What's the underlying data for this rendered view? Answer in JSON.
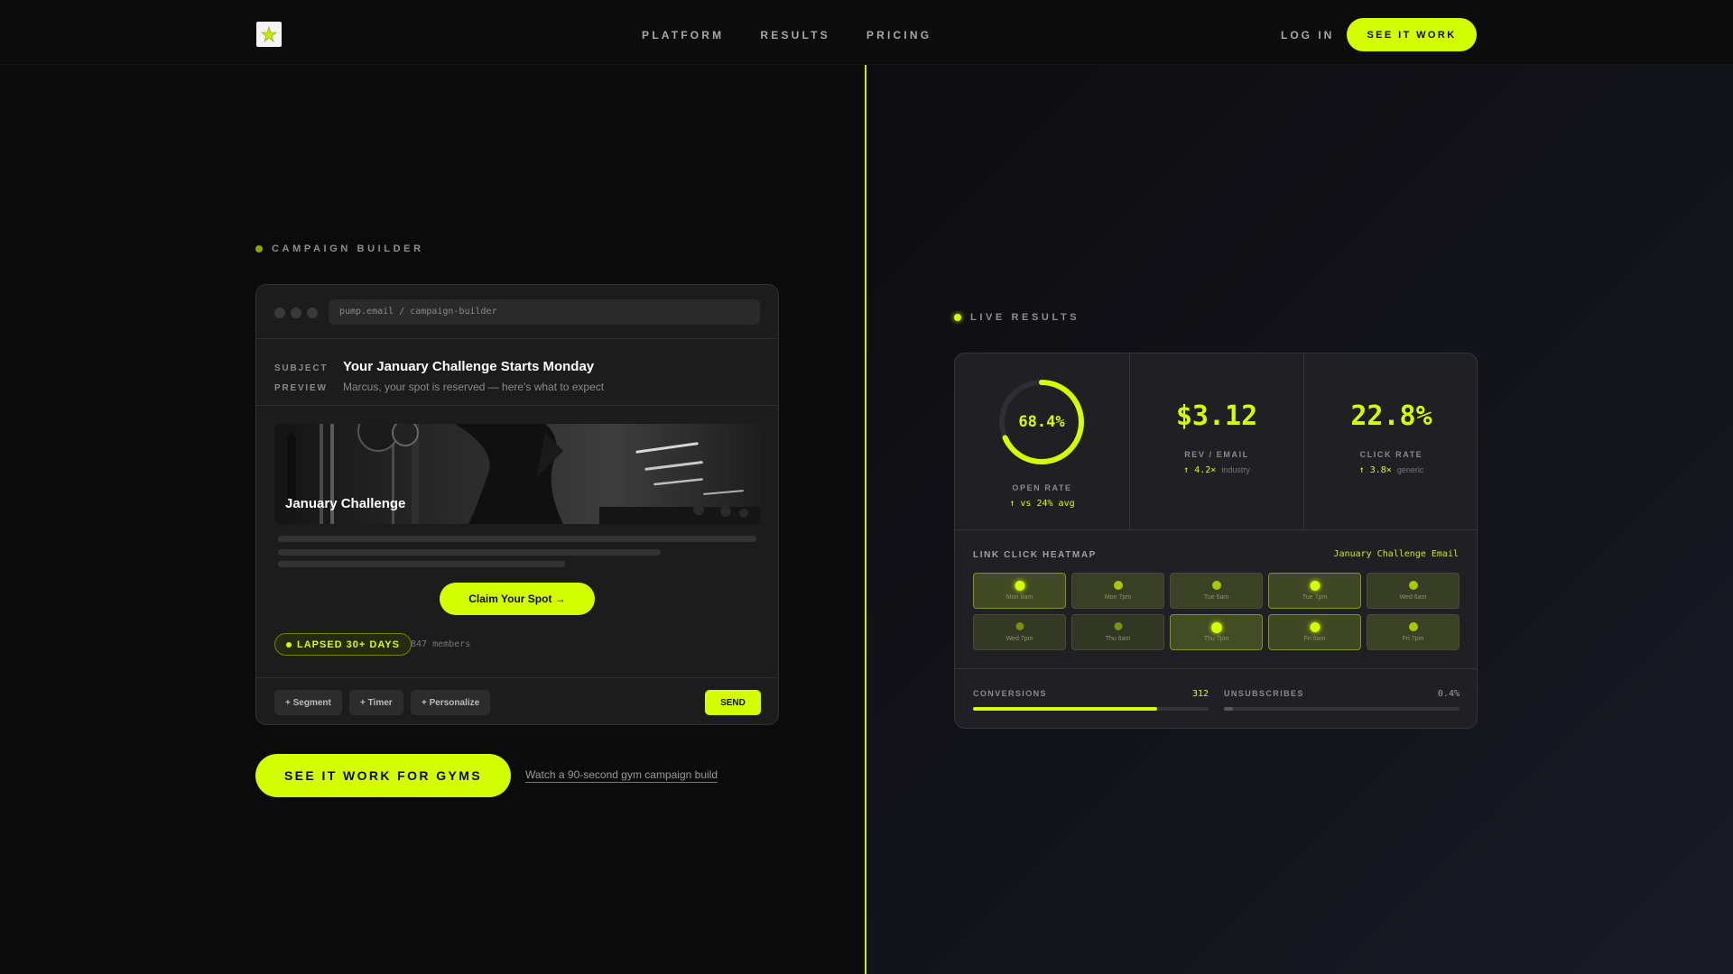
{
  "nav": {
    "links": [
      "PLATFORM",
      "RESULTS",
      "PRICING"
    ],
    "login": "LOG IN",
    "cta": "SEE IT WORK"
  },
  "builder": {
    "section_label": "CAMPAIGN BUILDER",
    "url": "pump.email / campaign-builder",
    "subject_key": "SUBJECT",
    "subject": "Your January Challenge Starts Monday",
    "preview_key": "PREVIEW",
    "preview": "Marcus, your spot is reserved — here's what to expect",
    "hero_title": "January Challenge",
    "button": "Claim Your Spot →",
    "segment": "LAPSED 30+ DAYS",
    "members": "847 members",
    "tools": [
      "+ Segment",
      "+ Timer",
      "+ Personalize"
    ],
    "send": "SEND"
  },
  "cta": {
    "main": "SEE IT WORK FOR GYMS",
    "secondary": "Watch a 90-second gym campaign build"
  },
  "results": {
    "section_label": "LIVE RESULTS",
    "open_rate": {
      "value": "68.4%",
      "fraction": 0.684,
      "label": "OPEN RATE",
      "sub": "↑ vs 24% avg"
    },
    "rev_email": {
      "value": "$3.12",
      "label": "REV / EMAIL",
      "sub": "↑ 4.2×",
      "sub_muted": "industry"
    },
    "click_rate": {
      "value": "22.8%",
      "label": "CLICK RATE",
      "sub": "↑ 3.8×",
      "sub_muted": "generic"
    },
    "heatmap": {
      "title": "LINK CLICK HEATMAP",
      "email": "January Challenge Email",
      "cells": [
        {
          "label": "Mon 8am",
          "intensity": 0.85
        },
        {
          "label": "Mon 7pm",
          "intensity": 0.55
        },
        {
          "label": "Tue 6am",
          "intensity": 0.6
        },
        {
          "label": "Tue 7pm",
          "intensity": 0.8
        },
        {
          "label": "Wed 6am",
          "intensity": 0.5
        },
        {
          "label": "Wed 7pm",
          "intensity": 0.35
        },
        {
          "label": "Thu 6am",
          "intensity": 0.3
        },
        {
          "label": "Thu 7pm",
          "intensity": 0.9
        },
        {
          "label": "Fri 6am",
          "intensity": 0.8
        },
        {
          "label": "Fri 7pm",
          "intensity": 0.6
        }
      ]
    },
    "conversions": {
      "label": "CONVERSIONS",
      "value": "312",
      "fraction": 0.78
    },
    "unsubscribes": {
      "label": "UNSUBSCRIBES",
      "value": "0.4%",
      "fraction": 0.04
    },
    "colors": {
      "accent": "#d4ff00",
      "muted_bar": "#55555c"
    }
  }
}
